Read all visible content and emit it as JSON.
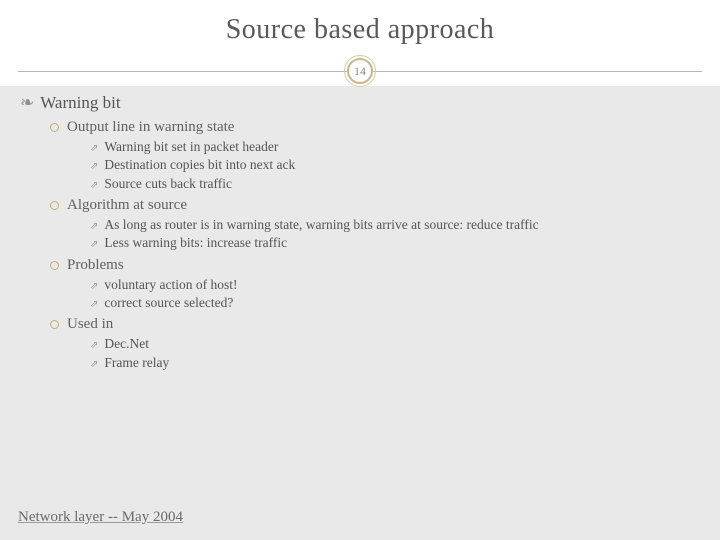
{
  "title": "Source based approach",
  "page_number": "14",
  "heading": {
    "bullet": "❧",
    "text": "Warning bit"
  },
  "sections": [
    {
      "label": "Output line in warning state",
      "items": [
        "Warning bit set in packet header",
        "Destination copies bit into next ack",
        "Source cuts back traffic"
      ]
    },
    {
      "label": "Algorithm at source",
      "items": [
        "As long as router is in warning state,  warning bits arrive at source: reduce traffic",
        "Less warning bits: increase traffic"
      ]
    },
    {
      "label": "Problems",
      "items": [
        "voluntary action of host!",
        "correct source selected?"
      ]
    },
    {
      "label": "Used in",
      "items": [
        "Dec.Net",
        "Frame relay"
      ]
    }
  ],
  "sub_bullet": "⇗",
  "footer": "Network  layer  --  May 2004"
}
